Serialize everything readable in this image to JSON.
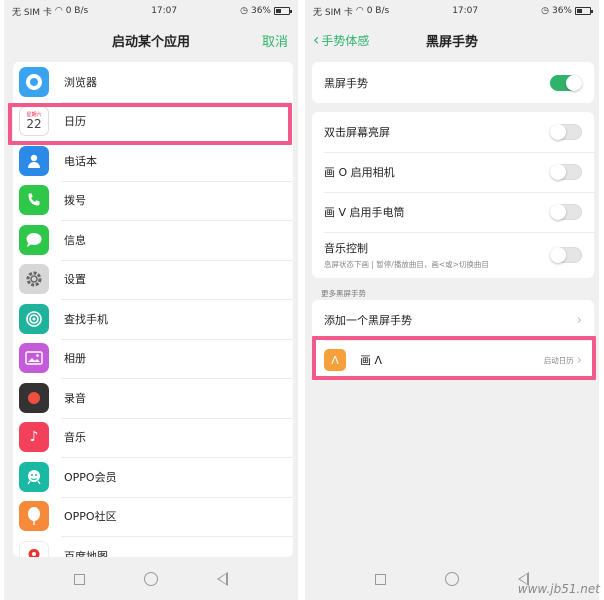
{
  "left": {
    "status": {
      "carrier": "无 SIM 卡",
      "speed": "0 B/s",
      "time": "17:07",
      "battery": "36%"
    },
    "title": "启动某个应用",
    "cancel_label": "取消",
    "apps": [
      {
        "label": "浏览器",
        "icon": "browser-icon"
      },
      {
        "label": "日历",
        "icon": "calendar-icon",
        "cal_top": "星期六",
        "cal_day": "22"
      },
      {
        "label": "电话本",
        "icon": "contacts-icon"
      },
      {
        "label": "拨号",
        "icon": "phone-icon"
      },
      {
        "label": "信息",
        "icon": "messages-icon"
      },
      {
        "label": "设置",
        "icon": "settings-icon"
      },
      {
        "label": "查找手机",
        "icon": "find-phone-icon"
      },
      {
        "label": "相册",
        "icon": "album-icon"
      },
      {
        "label": "录音",
        "icon": "recorder-icon"
      },
      {
        "label": "音乐",
        "icon": "music-icon"
      },
      {
        "label": "OPPO会员",
        "icon": "oppo-member-icon"
      },
      {
        "label": "OPPO社区",
        "icon": "oppo-community-icon"
      },
      {
        "label": "百度地图",
        "icon": "baidu-map-icon"
      }
    ]
  },
  "right": {
    "status": {
      "carrier": "无 SIM 卡",
      "speed": "0 B/s",
      "time": "17:07",
      "battery": "36%"
    },
    "back_label": "手势体感",
    "title": "黑屏手势",
    "main_toggle": {
      "label": "黑屏手势",
      "on": true
    },
    "options": [
      {
        "label": "双击屏幕亮屏",
        "on": false
      },
      {
        "label": "画 O 启用相机",
        "on": false
      },
      {
        "label": "画 V 启用手电筒",
        "on": false
      },
      {
        "label": "音乐控制",
        "sub": "息屏状态下画 | 暂停/播放曲目，画<或>切换曲目",
        "on": false
      }
    ],
    "more_header": "更多黑屏手势",
    "add_label": "添加一个黑屏手势",
    "custom_gesture": {
      "symbol": "Λ",
      "label": "画 Λ",
      "status": "启动日历"
    }
  },
  "watermark": "www.jb51.net",
  "colors": {
    "accent": "#2fb36b",
    "highlight": "#f25a8c"
  }
}
